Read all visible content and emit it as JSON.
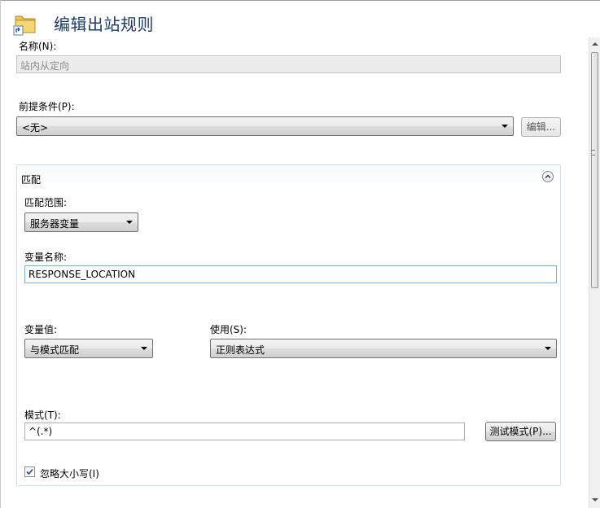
{
  "header": {
    "title": "编辑出站规则",
    "icon": "folder-rule-icon"
  },
  "name_field": {
    "label": "名称(N):",
    "value": "站内从定向"
  },
  "precondition": {
    "label": "前提条件(P):",
    "value": "<无>",
    "edit_button": "编辑..."
  },
  "match": {
    "title": "匹配",
    "scope_label": "匹配范围:",
    "scope_value": "服务器变量",
    "variable_name_label": "变量名称:",
    "variable_name_value": "RESPONSE_LOCATION",
    "variable_value_label": "变量值:",
    "variable_value_value": "与模式匹配",
    "using_label": "使用(S):",
    "using_value": "正则表达式",
    "pattern_label": "模式(T):",
    "pattern_value": "^(.*)",
    "test_button": "测试模式(P)...",
    "ignore_case_label": "忽略大小写(I)",
    "ignore_case_checked": true
  }
}
